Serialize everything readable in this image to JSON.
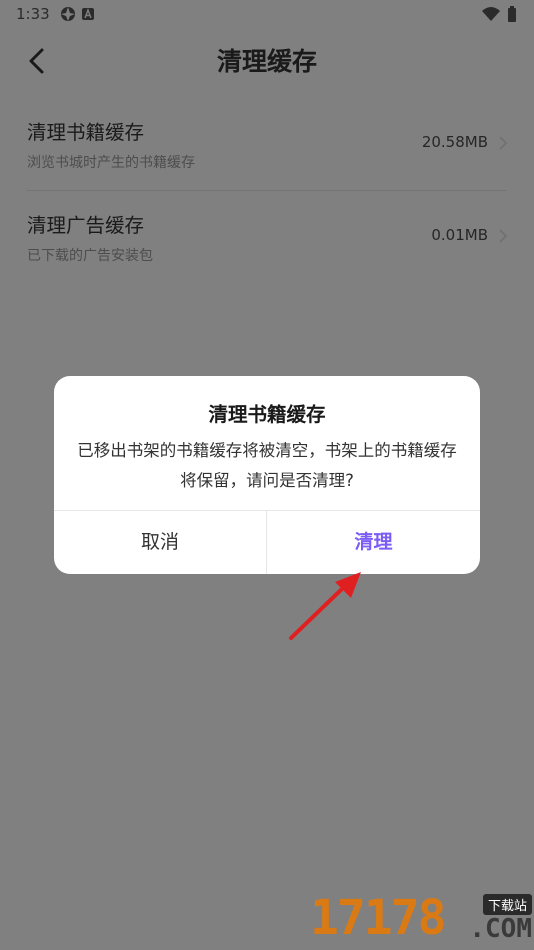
{
  "status_bar": {
    "time": "1:33"
  },
  "header": {
    "title": "清理缓存"
  },
  "settings": {
    "items": [
      {
        "title": "清理书籍缓存",
        "description": "浏览书城时产生的书籍缓存",
        "value": "20.58MB"
      },
      {
        "title": "清理广告缓存",
        "description": "已下载的广告安装包",
        "value": "0.01MB"
      }
    ]
  },
  "dialog": {
    "title": "清理书籍缓存",
    "message": "已移出书架的书籍缓存将被清空，书架上的书籍缓存将保留，请问是否清理?",
    "cancel_label": "取消",
    "confirm_label": "清理"
  },
  "watermark": {
    "digits": "17178",
    "badge": "下载站",
    "domain": ".COM"
  },
  "colors": {
    "accent": "#7b5cf5",
    "overlay": "#808080",
    "arrow": "#e02020"
  },
  "icons": [
    "aperture-icon",
    "a-box-icon",
    "wifi-icon",
    "battery-icon",
    "back-arrow-icon",
    "chevron-right-icon"
  ]
}
